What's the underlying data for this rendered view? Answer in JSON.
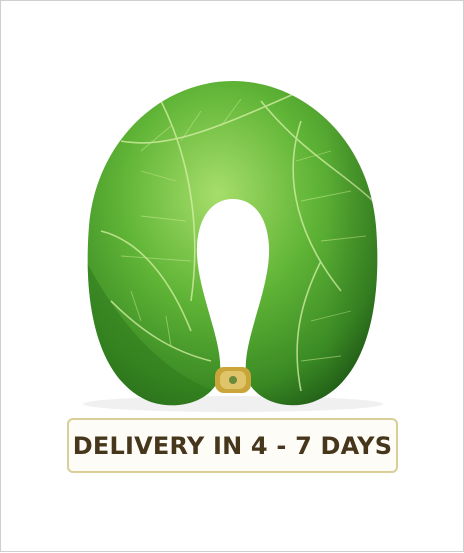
{
  "product": {
    "name_icon": "leaf-neck-pillow-image",
    "colors": {
      "pillow_light": "#8fd05a",
      "pillow_mid": "#4a9e2c",
      "pillow_dark": "#1f5a16",
      "vein": "#d8f0a8",
      "clasp": "#c9a53a"
    }
  },
  "badge": {
    "text": "DELIVERY IN 4 - 7 DAYS",
    "border_color": "#d9cd9a",
    "text_color": "#46361c"
  }
}
